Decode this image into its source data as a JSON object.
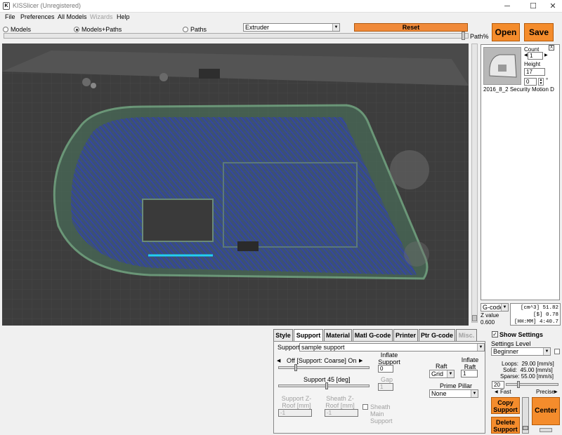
{
  "window": {
    "title": "KISSlicer (Unregistered)",
    "min": "─",
    "max": "☐",
    "close": "✕"
  },
  "menu": [
    "File",
    "Preferences",
    "All Models",
    "Wizards",
    "Help"
  ],
  "view_modes": {
    "models": "Models",
    "models_paths": "Models+Paths",
    "paths": "Paths",
    "selected": "Models+Paths"
  },
  "extruder_select": "Extruder",
  "reset_label": "Reset",
  "path_label": "Path%",
  "open_label": "Open",
  "save_label": "Save",
  "model": {
    "count_label": "Count",
    "count": "1",
    "height_label": "Height",
    "height": "17",
    "rotation": "0",
    "degree": "°",
    "name": "2016_8_2 Security Motion D",
    "close": "X"
  },
  "gcode": {
    "select": "G-code",
    "zvalue_label": "Z value",
    "zvalue": "0.600",
    "vol_unit": "[cm^3]",
    "vol": "51.82",
    "layers_unit": "[$]",
    "layers": "0.78",
    "time_unit": "[HH:MM]",
    "time": "4:40.7"
  },
  "tabs": [
    {
      "label": "Style"
    },
    {
      "label": "Support"
    },
    {
      "label": "Material"
    },
    {
      "label": "Matl G-code"
    },
    {
      "label": "Printer"
    },
    {
      "label": "Ptr G-code"
    },
    {
      "label": "Misc."
    }
  ],
  "support": {
    "label": "Support",
    "profile": "sample support",
    "inflate_label": "Inflate Support",
    "inflate": "0",
    "slider_label": "Off [Support: Coarse] On",
    "angle_label": "Support 45 [deg]",
    "gap_label": "Gap",
    "gap": "1",
    "zroof_label": "Support Z-Roof [mm]",
    "zroof": "-1",
    "sheath_label": "Sheath Z-Roof [mm]",
    "sheath": "-1",
    "sheath_main_label": "Sheath Main Support",
    "raft_label": "Raft",
    "raft": "Grid",
    "inflate_raft_label": "Inflate Raft",
    "inflate_raft": "1",
    "prime_label": "Prime Pillar",
    "prime": "None"
  },
  "settings": {
    "show_label": "Show Settings",
    "level_label": "Settings Level",
    "level": "Beginner",
    "loops": "Loops:  29.00 [mm/s]",
    "solid": "Solid:  45.00 [mm/s]",
    "sparse": "Sparse: 55.00 [mm/s]",
    "speed": "20",
    "fast": "Fast",
    "precise": "Precise"
  },
  "buttons": {
    "copy_support": "Copy Support",
    "delete_support": "Delete Support",
    "center": "Center"
  },
  "colors": {
    "accent": "#f48c2c",
    "path_blue": "#2f3fd0",
    "model_green": "#6fcf8f"
  }
}
